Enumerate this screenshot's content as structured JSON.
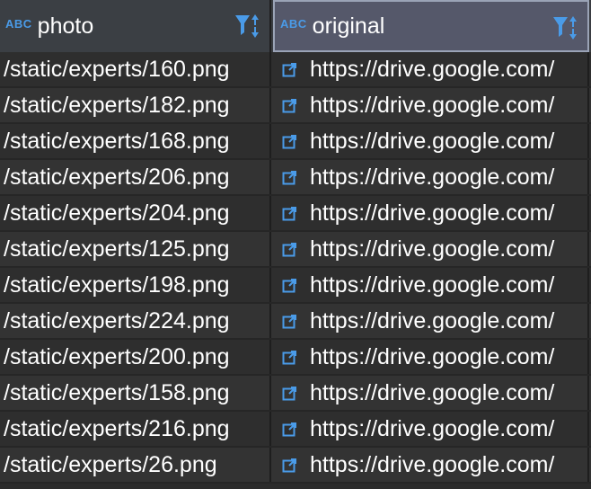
{
  "columns": {
    "photo": {
      "type_badge": "ABC",
      "label": "photo",
      "icon": "filter-sort-icon"
    },
    "original": {
      "type_badge": "ABC",
      "label": "original",
      "icon": "filter-sort-icon"
    }
  },
  "colors": {
    "accent": "#4a9be8",
    "header_bg": "#3b3f44",
    "selected_header_bg": "#55586a",
    "row_bg": "#2e2e2e",
    "text": "#ffffff"
  },
  "rows": [
    {
      "photo": "/static/experts/160.png",
      "original": "https://drive.google.com/"
    },
    {
      "photo": "/static/experts/182.png",
      "original": "https://drive.google.com/"
    },
    {
      "photo": "/static/experts/168.png",
      "original": "https://drive.google.com/"
    },
    {
      "photo": "/static/experts/206.png",
      "original": "https://drive.google.com/"
    },
    {
      "photo": "/static/experts/204.png",
      "original": "https://drive.google.com/"
    },
    {
      "photo": "/static/experts/125.png",
      "original": "https://drive.google.com/"
    },
    {
      "photo": "/static/experts/198.png",
      "original": "https://drive.google.com/"
    },
    {
      "photo": "/static/experts/224.png",
      "original": "https://drive.google.com/"
    },
    {
      "photo": "/static/experts/200.png",
      "original": "https://drive.google.com/"
    },
    {
      "photo": "/static/experts/158.png",
      "original": "https://drive.google.com/"
    },
    {
      "photo": "/static/experts/216.png",
      "original": "https://drive.google.com/"
    },
    {
      "photo": "/static/experts/26.png",
      "original": "https://drive.google.com/"
    }
  ]
}
